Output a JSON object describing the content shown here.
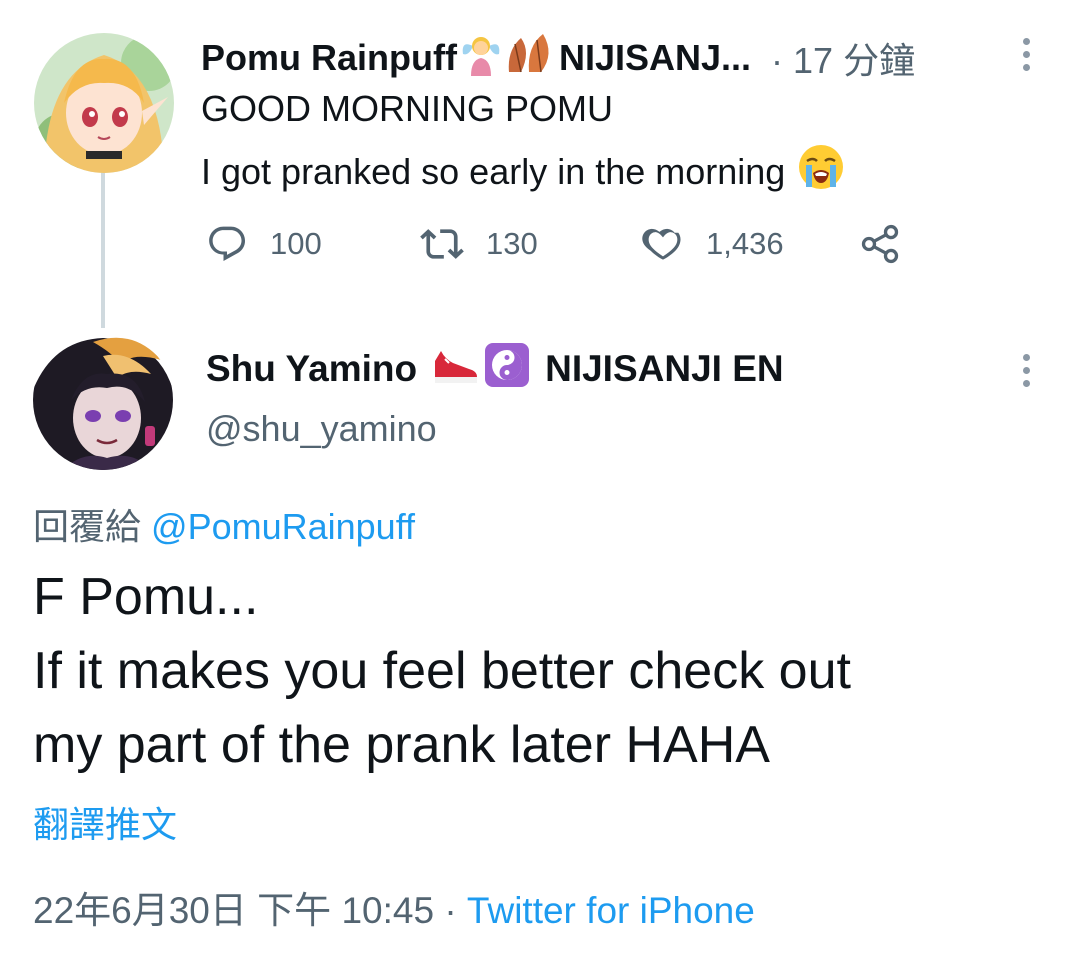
{
  "tweet1": {
    "author_name": "Pomu Rainpuff",
    "author_name_suffix": "NIJISANJ...",
    "time": "· 17 分鐘",
    "line1": "GOOD MORNING POMU",
    "line2": "I got pranked so early in the morning",
    "icons": [
      "fairy-emoji-icon",
      "leaf-emoji-icon",
      "crying-face-emoji-icon"
    ],
    "actions": {
      "reply_count": "100",
      "retweet_count": "130",
      "like_count": "1,436"
    }
  },
  "tweet2": {
    "author_name": "Shu Yamino",
    "author_name_suffix": "NIJISANJI EN",
    "handle": "@shu_yamino",
    "icons": [
      "sneaker-emoji-icon",
      "yin-yang-emoji-icon"
    ],
    "reply_prefix": "回覆給",
    "reply_mention": "@PomuRainpuff",
    "body_lines": [
      "F Pomu...",
      "If it makes you feel better check out",
      "my part of the prank later HAHA"
    ],
    "translate_label": "翻譯推文",
    "timestamp": "22年6月30日 下午 10:45 · ",
    "source": "Twitter for iPhone"
  },
  "colors": {
    "accent": "#1d9bf0",
    "secondary_text": "#536471",
    "primary_text": "#0f1419",
    "thread_line": "#cfd9de"
  }
}
